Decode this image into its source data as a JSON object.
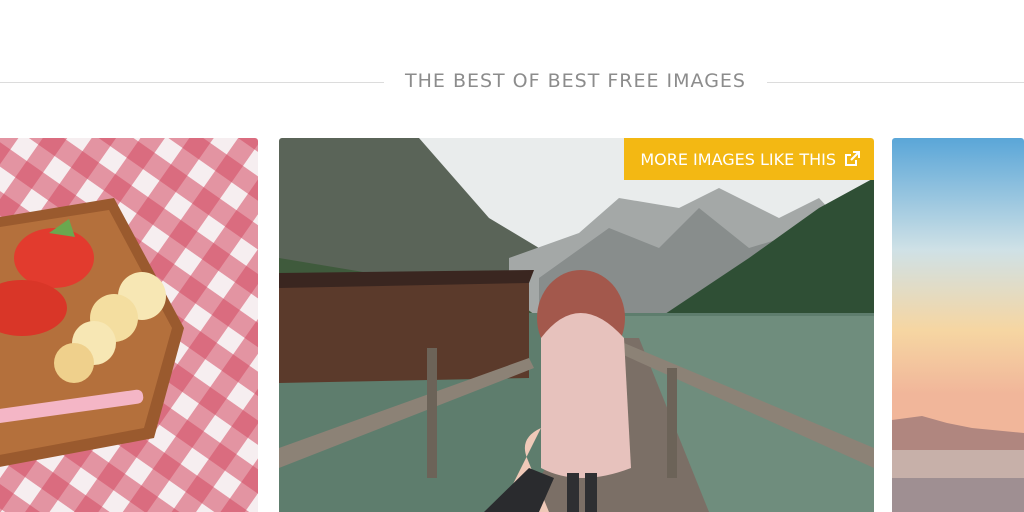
{
  "section": {
    "heading": "THE BEST OF BEST FREE IMAGES"
  },
  "gallery": {
    "cards": [
      {
        "photo_icon": "picnic-fruit-photo"
      },
      {
        "photo_icon": "lake-pier-photo",
        "more_button_label": "MORE IMAGES LIKE THIS",
        "more_button_icon": "external-link-icon"
      },
      {
        "photo_icon": "sunset-sea-photo"
      }
    ]
  },
  "colors": {
    "accent": "#f3b813",
    "heading": "#8c8c8c",
    "divider": "#dcdcdc"
  }
}
